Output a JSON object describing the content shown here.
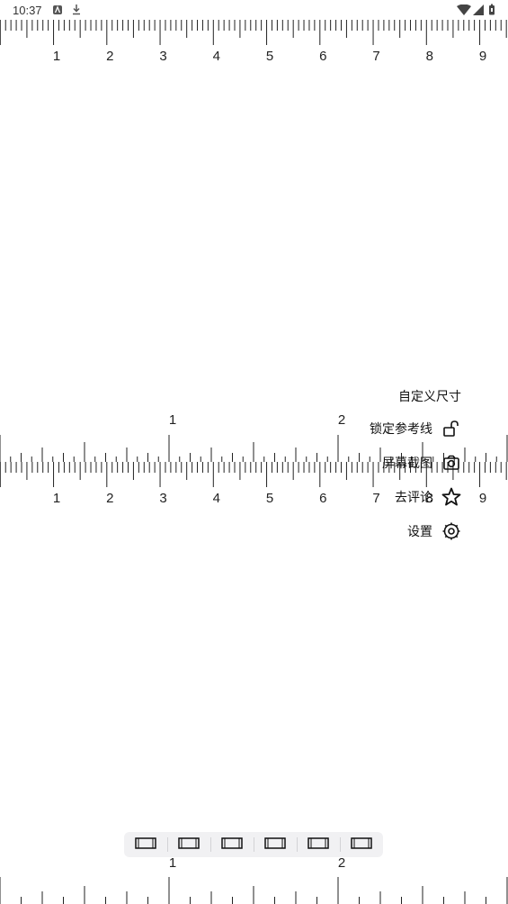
{
  "status_bar": {
    "time": "10:37",
    "left_icons": [
      "app-notification-icon",
      "download-icon"
    ],
    "right_icons": [
      "wifi-icon",
      "signal-icon",
      "battery-icon"
    ]
  },
  "top_ruler": {
    "labels": [
      "1",
      "2",
      "3",
      "4",
      "5",
      "6",
      "7",
      "8",
      "9"
    ]
  },
  "middle_ruler": {
    "upper_labels": [
      "1",
      "2"
    ],
    "lower_labels": [
      "1",
      "2",
      "3",
      "4",
      "5",
      "6",
      "7",
      "8",
      "9"
    ]
  },
  "bottom_ruler": {
    "labels": [
      "1",
      "2"
    ]
  },
  "menu": {
    "items": [
      {
        "label": "自定义尺寸",
        "icon": ""
      },
      {
        "label": "锁定参考线",
        "icon": "unlock-icon"
      },
      {
        "label": "屏幕截图",
        "icon": "camera-icon"
      },
      {
        "label": "去评论",
        "icon": "star-icon"
      },
      {
        "label": "设置",
        "icon": "gear-icon"
      }
    ]
  },
  "toolbar": {
    "buttons": [
      "ruler-mode-icon",
      "ruler-mode-icon",
      "ruler-mode-icon",
      "ruler-mode-icon",
      "ruler-mode-icon",
      "ruler-mode-icon"
    ]
  }
}
